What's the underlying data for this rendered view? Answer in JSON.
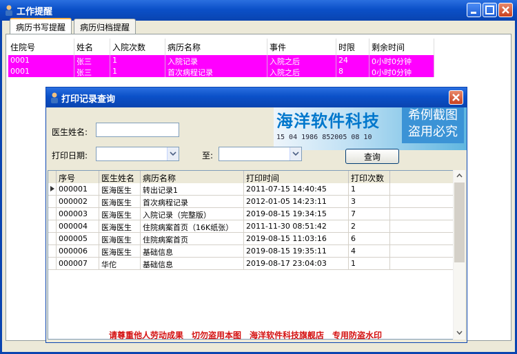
{
  "window": {
    "title": "工作提醒"
  },
  "tabs": [
    {
      "label": "病历书写提醒",
      "active": true
    },
    {
      "label": "病历归档提醒",
      "active": false
    }
  ],
  "reminder_table": {
    "columns": [
      "住院号",
      "姓名",
      "入院次数",
      "病历名称",
      "事件",
      "时限",
      "剩余时间"
    ],
    "rows": [
      [
        "0001",
        "张三",
        "1",
        "入院记录",
        "入院之后",
        "24",
        "0小时0分钟"
      ],
      [
        "0001",
        "张三",
        "1",
        "首次病程记录",
        "入院之后",
        "8",
        "0小时0分钟"
      ]
    ],
    "highlight_color": "#ff00ff"
  },
  "dialog": {
    "title": "打印记录查询",
    "doctor_label": "医生姓名:",
    "doctor_value": "",
    "date_label": "打印日期:",
    "to_label": "至:",
    "date_from": "",
    "date_to": "",
    "query_button": "查询",
    "watermark": {
      "name": "海洋软件科技",
      "code": "15 04 1986 852005 08 10",
      "side_line1": "希例截图",
      "side_line2": "盗用必究"
    },
    "records": {
      "columns": [
        "序号",
        "医生姓名",
        "病历名称",
        "打印时间",
        "打印次数"
      ],
      "rows": [
        [
          "000001",
          "医海医生",
          "转出记录1",
          "2011-07-15 14:40:45",
          "1"
        ],
        [
          "000002",
          "医海医生",
          "首次病程记录",
          "2012-01-05 14:23:11",
          "3"
        ],
        [
          "000003",
          "医海医生",
          "入院记录（完整版）",
          "2019-08-15 19:34:15",
          "7"
        ],
        [
          "000004",
          "医海医生",
          "住院病案首页（16K纸张）",
          "2011-11-30 08:51:42",
          "2"
        ],
        [
          "000005",
          "医海医生",
          "住院病案首页",
          "2019-08-15 11:03:16",
          "6"
        ],
        [
          "000006",
          "医海医生",
          "基础信息",
          "2019-08-15 19:35:11",
          "4"
        ],
        [
          "000007",
          "华佗",
          "基础信息",
          "2019-08-17 23:04:03",
          "1"
        ]
      ]
    }
  },
  "bottom_watermark": "请尊重他人劳动成果　切勿盗用本图　海洋软件科技旗舰店　专用防盗水印",
  "colors": {
    "titlebar": "#0b50c8",
    "accent": "#ff00ff",
    "watermark_red": "#d41010"
  }
}
